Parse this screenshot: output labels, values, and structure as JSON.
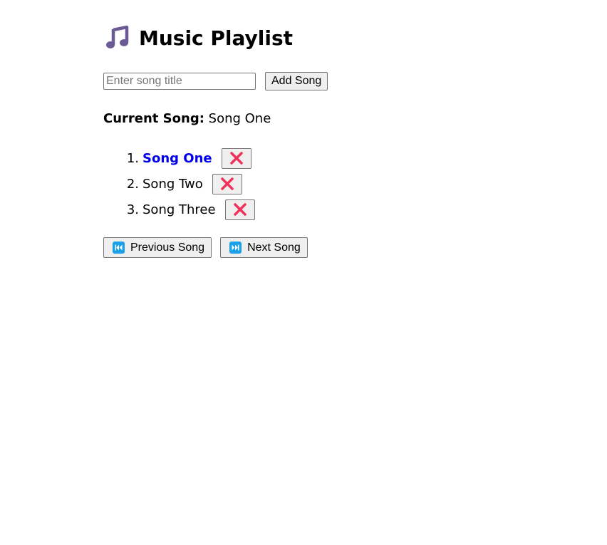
{
  "header": {
    "title": "Music Playlist",
    "icon": "musical-note-icon",
    "icon_color": "#6b5b95"
  },
  "add_song": {
    "input_value": "",
    "placeholder": "Enter song title",
    "button_label": "Add Song"
  },
  "current": {
    "label": "Current Song:",
    "value": "Song One"
  },
  "playlist": {
    "active_color": "#0000ee",
    "remove_icon": "cross-mark-icon",
    "remove_icon_color": "#f0325a",
    "items": [
      {
        "number": "1.",
        "title": "Song One",
        "active": true
      },
      {
        "number": "2.",
        "title": "Song Two",
        "active": false
      },
      {
        "number": "3.",
        "title": "Song Three",
        "active": false
      }
    ]
  },
  "controls": {
    "icon_color": "#1aa0e6",
    "previous_label": "Previous Song",
    "previous_icon": "previous-track-icon",
    "next_label": "Next Song",
    "next_icon": "next-track-icon"
  }
}
